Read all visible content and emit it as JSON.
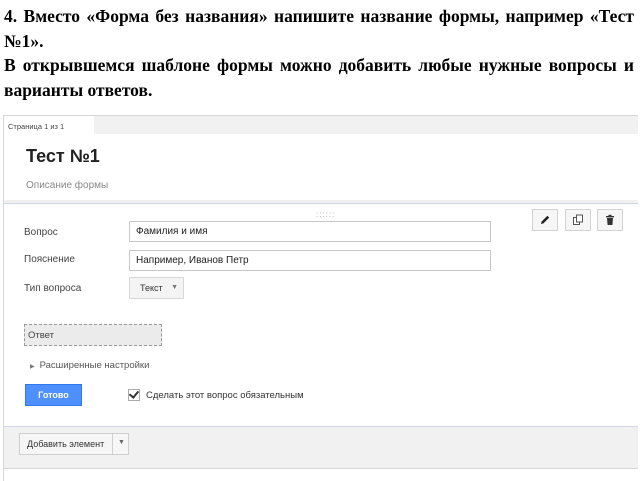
{
  "instructions": {
    "line1": "4. Вместо «Форма без названия» напишите название формы, например «Тест №1».",
    "line2": "В открывшемся шаблоне формы можно добавить любые нужные вопросы и варианты ответов."
  },
  "editor": {
    "page_indicator": "Страница 1 из 1",
    "form_title": "Тест №1",
    "form_description_placeholder": "Описание формы",
    "question": {
      "drag_handle": "::::::",
      "question_label": "Вопрос",
      "question_value": "Фамилия и имя",
      "help_label": "Пояснение",
      "help_value": "Например, Иванов Петр",
      "type_label": "Тип вопроса",
      "type_value": "Текст",
      "answer_placeholder": "Ответ",
      "advanced_settings": "Расширенные настройки",
      "done_button": "Готово",
      "required_label": "Сделать этот вопрос обязательным",
      "required_checked": true,
      "toolbar_icons": [
        "pencil-icon",
        "copy-icon",
        "trash-icon"
      ]
    },
    "add_item_button": "Добавить элемент"
  },
  "colors": {
    "done_button_bg": "#4d90fe",
    "canvas_bg": "#f1f1f1"
  }
}
